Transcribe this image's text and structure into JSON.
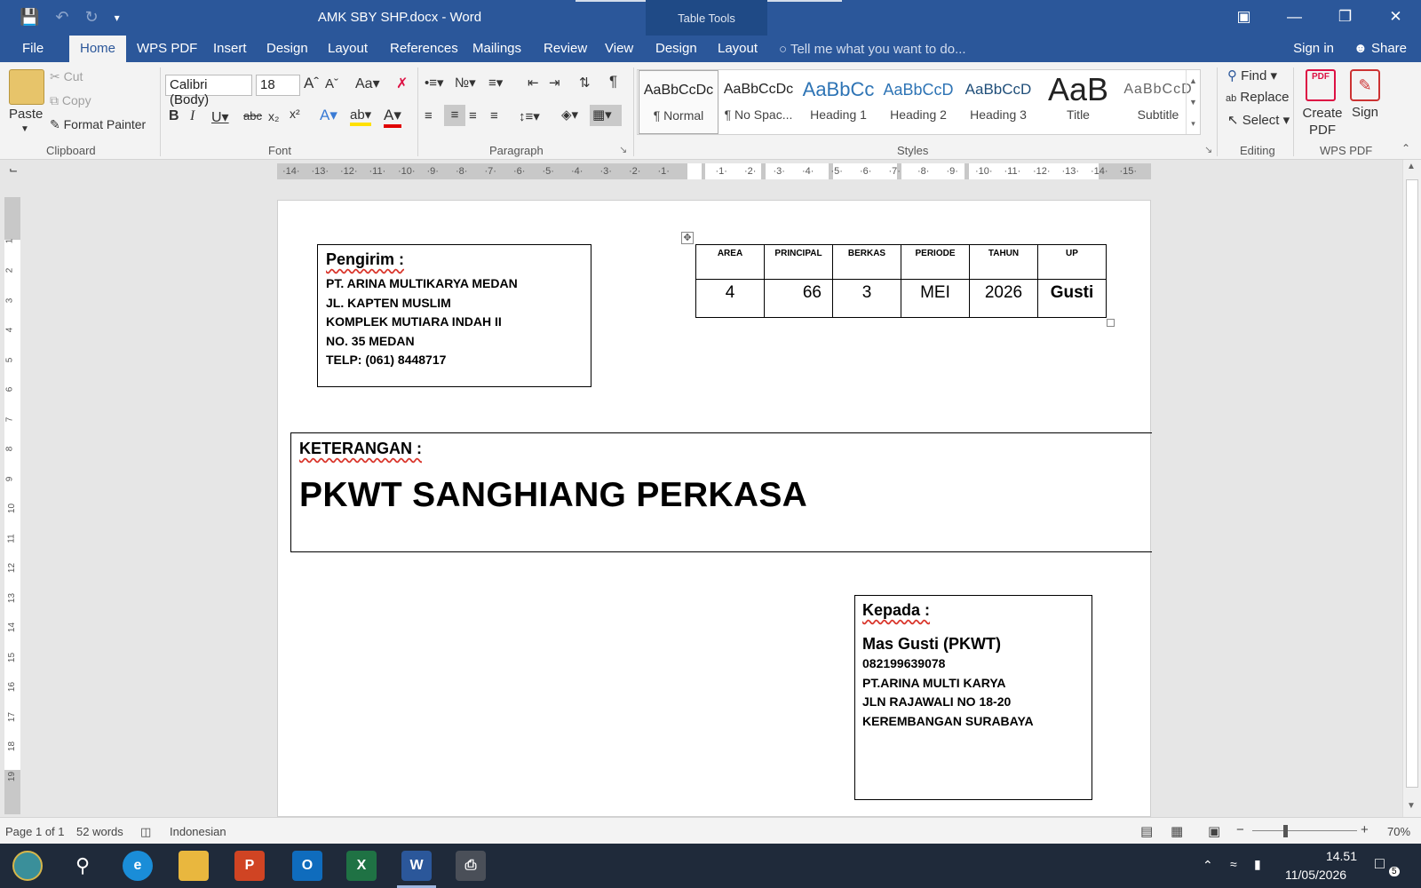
{
  "window": {
    "title": "AMK SBY SHP.docx - Word",
    "context_tab": "Table Tools"
  },
  "menu": {
    "tabs": [
      "File",
      "Home",
      "WPS PDF",
      "Insert",
      "Design",
      "Layout",
      "References",
      "Mailings",
      "Review",
      "View",
      "Design",
      "Layout"
    ],
    "active": "Home",
    "tell_me": "Tell me what you want to do...",
    "sign_in": "Sign in",
    "share": "Share"
  },
  "ribbon": {
    "clipboard": {
      "paste": "Paste",
      "cut": "Cut",
      "copy": "Copy",
      "format_painter": "Format Painter",
      "label": "Clipboard"
    },
    "font": {
      "family": "Calibri (Body)",
      "size": "18",
      "label": "Font"
    },
    "paragraph": {
      "label": "Paragraph"
    },
    "styles": {
      "label": "Styles",
      "items": [
        {
          "preview": "AaBbCcDc",
          "name": "¶ Normal"
        },
        {
          "preview": "AaBbCcDc",
          "name": "¶ No Spac..."
        },
        {
          "preview": "AaBbCc",
          "name": "Heading 1"
        },
        {
          "preview": "AaBbCcD",
          "name": "Heading 2"
        },
        {
          "preview": "AaBbCcD",
          "name": "Heading 3"
        },
        {
          "preview": "AaB",
          "name": "Title"
        },
        {
          "preview": "AaBbCcD",
          "name": "Subtitle"
        }
      ]
    },
    "editing": {
      "find": "Find",
      "replace": "Replace",
      "select": "Select",
      "label": "Editing"
    },
    "wps_pdf": {
      "create_pdf": "Create PDF",
      "sign": "Sign",
      "label": "WPS PDF"
    }
  },
  "document": {
    "sender": {
      "heading": "Pengirim :",
      "lines": [
        "PT. ARINA MULTIKARYA MEDAN",
        "JL. KAPTEN MUSLIM",
        "KOMPLEK MUTIARA INDAH II",
        "NO. 35 MEDAN",
        "TELP: (061) 8448717"
      ]
    },
    "info_table": {
      "headers": [
        "AREA",
        "PRINCIPAL",
        "BERKAS",
        "PERIODE",
        "TAHUN",
        "UP"
      ],
      "values": [
        "4",
        "66",
        "3",
        "MEI",
        "2026",
        "Gusti"
      ]
    },
    "note": {
      "heading": "KETERANGAN :",
      "text": "PKWT SANGHIANG PERKASA"
    },
    "recipient": {
      "heading": "Kepada :",
      "name": "Mas Gusti (PKWT)",
      "lines": [
        "082199639078",
        "PT.ARINA MULTI KARYA",
        "JLN RAJAWALI NO 18-20",
        "KEREMBANGAN SURABAYA"
      ]
    }
  },
  "status": {
    "page": "Page 1 of 1",
    "words": "52 words",
    "language": "Indonesian",
    "zoom": "70%"
  },
  "taskbar": {
    "time": "14.51",
    "date": "11/05/2026",
    "notifications": "5"
  },
  "colors": {
    "word_blue": "#2b579a",
    "spell_red": "#d9352b"
  }
}
